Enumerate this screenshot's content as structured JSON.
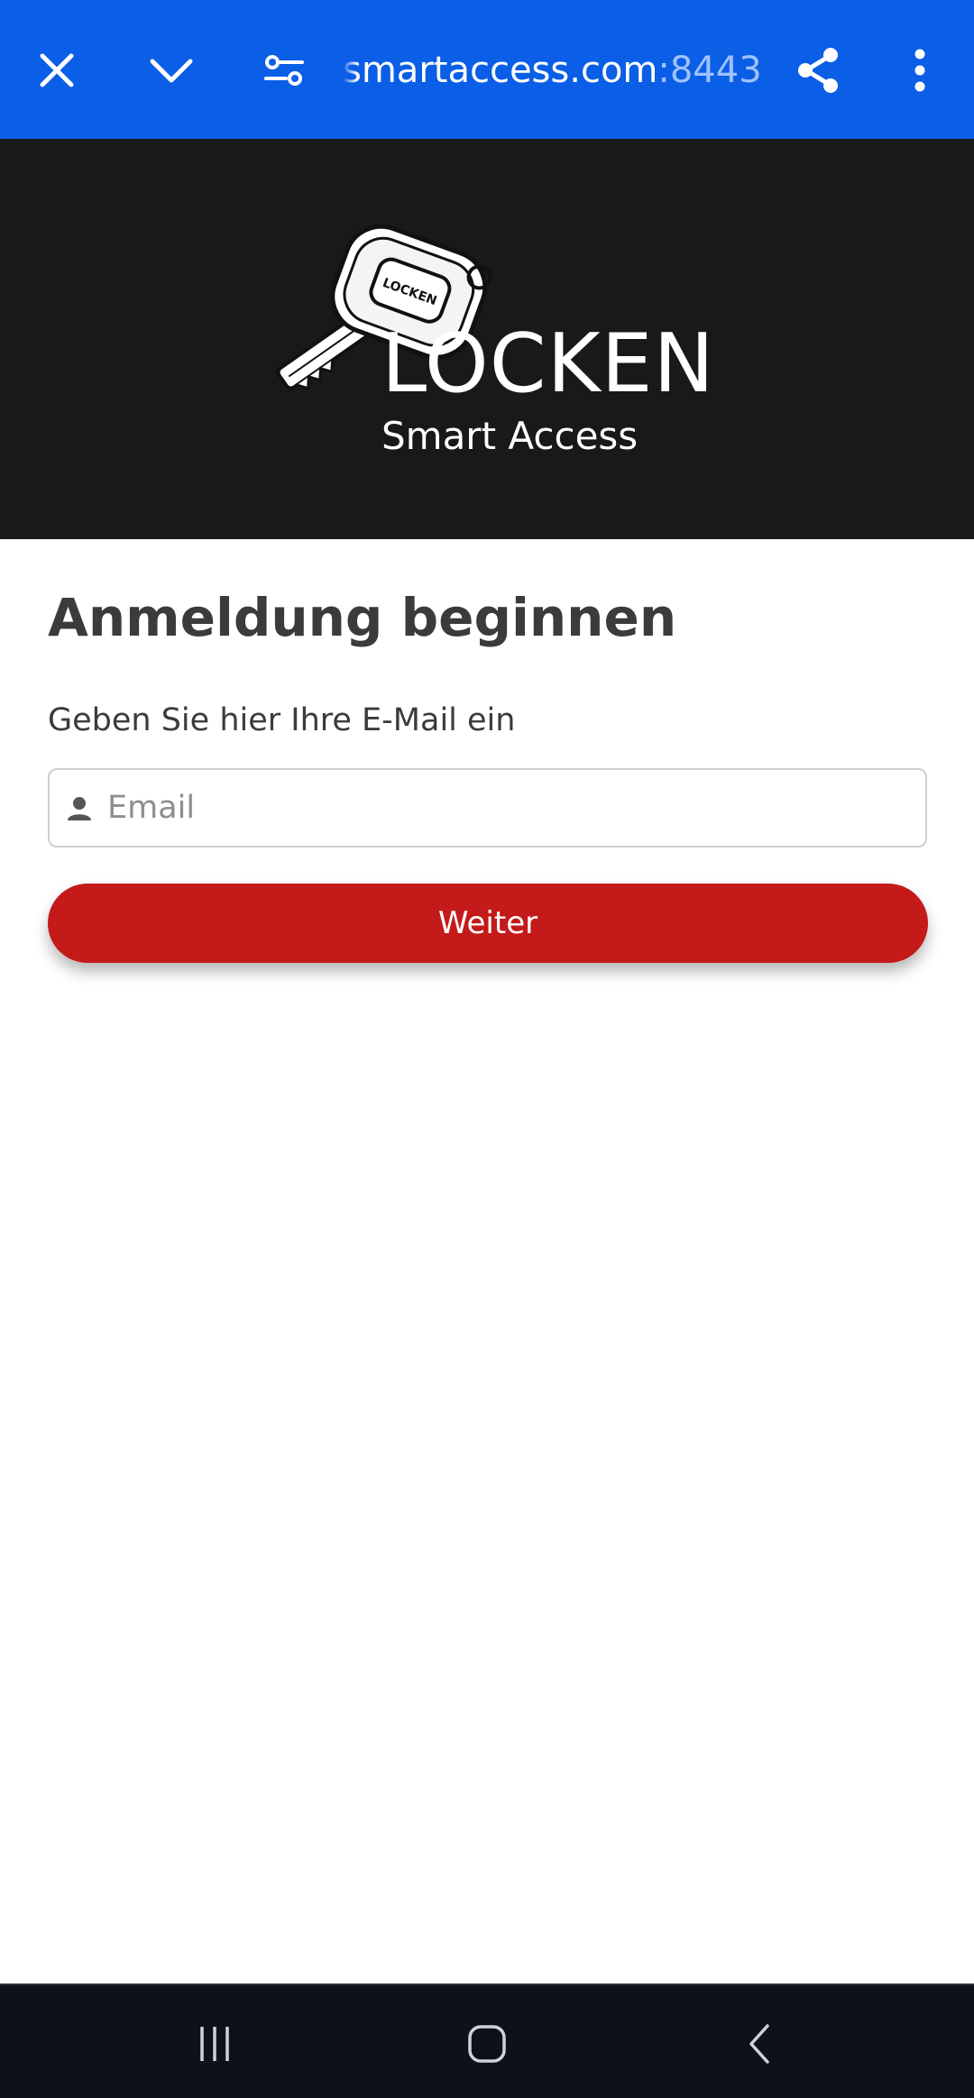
{
  "browser": {
    "url_host": "smartaccess.com",
    "url_port": ":8443",
    "icons": [
      "close-icon",
      "chevron-down-icon",
      "site-settings-icon",
      "share-icon",
      "more-vert-icon"
    ]
  },
  "brand": {
    "logo_key_label": "LOCKEN",
    "name": "LOCKEN",
    "tagline": "Smart Access"
  },
  "login": {
    "heading": "Anmeldung beginnen",
    "instruction": "Geben Sie hier Ihre E-Mail ein",
    "email_placeholder": "Email",
    "email_value": "",
    "submit_label": "Weiter"
  },
  "navbar": {
    "icons": [
      "recent-apps-icon",
      "home-icon",
      "back-icon"
    ]
  },
  "colors": {
    "browser_bar": "#0b5ee6",
    "brand_bg": "#191919",
    "accent_button": "#c41a1a",
    "navbar": "#0e111a"
  }
}
